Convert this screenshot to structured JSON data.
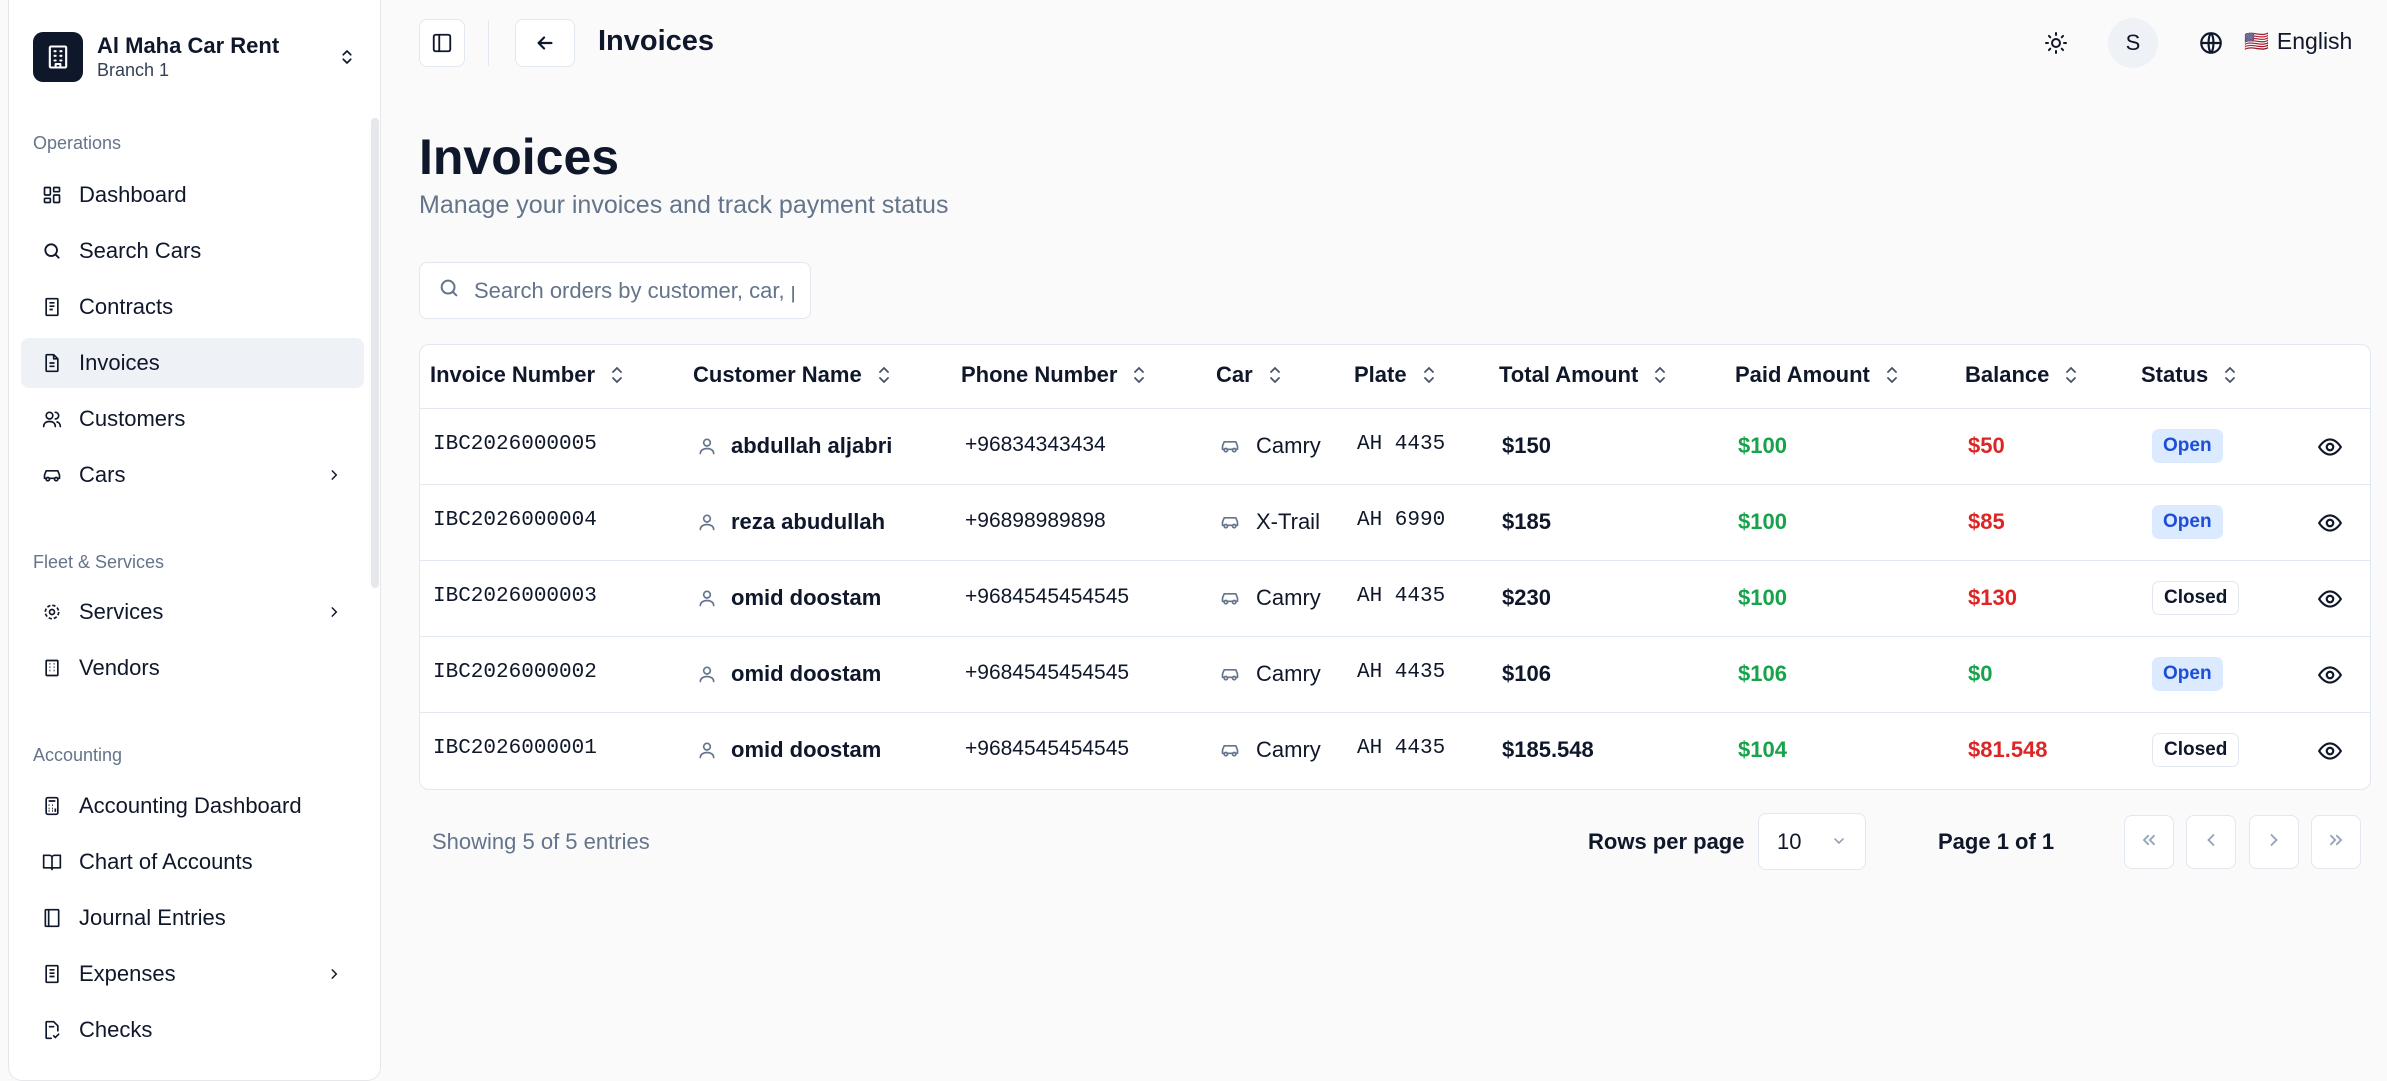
{
  "sidebar": {
    "brand": {
      "name": "Al Maha Car Rent",
      "branch": "Branch 1"
    },
    "sections": [
      {
        "title": "Operations"
      },
      {
        "title": "Fleet & Services"
      },
      {
        "title": "Accounting"
      }
    ],
    "items": [
      {
        "label": "Dashboard",
        "icon": "dashboard-icon"
      },
      {
        "label": "Search Cars",
        "icon": "search-icon"
      },
      {
        "label": "Contracts",
        "icon": "contract-icon"
      },
      {
        "label": "Invoices",
        "icon": "invoice-icon",
        "active": true
      },
      {
        "label": "Customers",
        "icon": "users-icon"
      },
      {
        "label": "Cars",
        "icon": "car-icon",
        "has_children": true
      },
      {
        "label": "Services",
        "icon": "gear-icon",
        "has_children": true
      },
      {
        "label": "Vendors",
        "icon": "building-icon"
      },
      {
        "label": "Accounting Dashboard",
        "icon": "calculator-icon"
      },
      {
        "label": "Chart of Accounts",
        "icon": "book-icon"
      },
      {
        "label": "Journal Entries",
        "icon": "journal-icon"
      },
      {
        "label": "Expenses",
        "icon": "receipt-icon",
        "has_children": true
      },
      {
        "label": "Checks",
        "icon": "check-icon"
      }
    ]
  },
  "header": {
    "title": "Invoices",
    "avatar_initial": "S",
    "language": {
      "flag": "🇺🇸",
      "label": "English"
    }
  },
  "page": {
    "title": "Invoices",
    "subtitle": "Manage your invoices and track payment status"
  },
  "search": {
    "placeholder": "Search orders by customer, car, plate...",
    "value": ""
  },
  "table": {
    "columns": [
      "Invoice Number",
      "Customer Name",
      "Phone Number",
      "Car",
      "Plate",
      "Total Amount",
      "Paid Amount",
      "Balance",
      "Status"
    ],
    "rows": [
      {
        "invoice": "IBC2026000005",
        "customer": "abdullah aljabri",
        "phone": "+96834343434",
        "car": "Camry",
        "plate": "AH 4435",
        "total": "$150",
        "paid": "$100",
        "balance": "$50",
        "balance_color": "#dc2626",
        "status": "Open"
      },
      {
        "invoice": "IBC2026000004",
        "customer": "reza abudullah",
        "phone": "+96898989898",
        "car": "X-Trail",
        "plate": "AH 6990",
        "total": "$185",
        "paid": "$100",
        "balance": "$85",
        "balance_color": "#dc2626",
        "status": "Open"
      },
      {
        "invoice": "IBC2026000003",
        "customer": "omid doostam",
        "phone": "+9684545454545",
        "car": "Camry",
        "plate": "AH 4435",
        "total": "$230",
        "paid": "$100",
        "balance": "$130",
        "balance_color": "#dc2626",
        "status": "Closed"
      },
      {
        "invoice": "IBC2026000002",
        "customer": "omid doostam",
        "phone": "+9684545454545",
        "car": "Camry",
        "plate": "AH 4435",
        "total": "$106",
        "paid": "$106",
        "balance": "$0",
        "balance_color": "#16a34a",
        "status": "Open"
      },
      {
        "invoice": "IBC2026000001",
        "customer": "omid doostam",
        "phone": "+9684545454545",
        "car": "Camry",
        "plate": "AH 4435",
        "total": "$185.548",
        "paid": "$104",
        "balance": "$81.548",
        "balance_color": "#dc2626",
        "status": "Closed"
      }
    ]
  },
  "pagination": {
    "showing": "Showing 5 of 5 entries",
    "rows_per_page_label": "Rows per page",
    "rows_per_page": "10",
    "page_of": "Page 1 of 1"
  },
  "colors": {
    "positive": "#16a34a",
    "negative": "#dc2626",
    "open_badge_bg": "#dbeafe",
    "open_badge_text": "#1d4ed8"
  }
}
